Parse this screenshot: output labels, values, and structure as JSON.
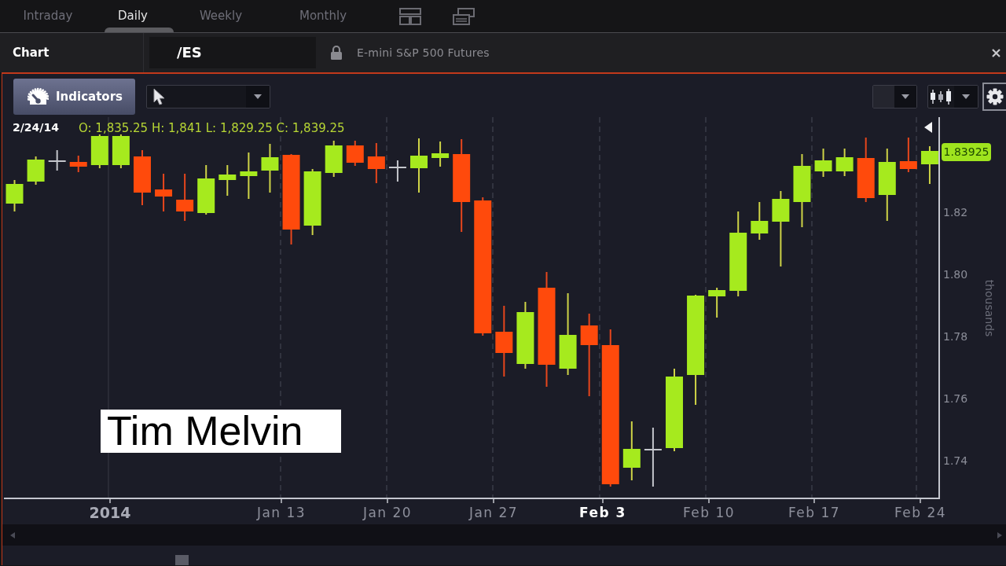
{
  "tabs": [
    {
      "label": "Intraday",
      "selected": false
    },
    {
      "label": "Daily",
      "selected": true
    },
    {
      "label": "Weekly",
      "selected": false
    },
    {
      "label": "Monthly",
      "selected": false
    }
  ],
  "panel": {
    "title": "Chart",
    "symbol": "/ES",
    "description": "E-mini S&P 500 Futures"
  },
  "toolbar": {
    "indicators_button": "Indicators"
  },
  "chart": {
    "readout": {
      "date": "2/24/14",
      "ohlc": "O: 1,835.25 H: 1,841 L: 1,829.25 C: 1,839.25"
    },
    "last_price": "1.83925",
    "y_ticks": [
      "1.82",
      "1.80",
      "1.78",
      "1.76",
      "1.74"
    ],
    "y_unit": "thousands",
    "x_labels": [
      {
        "text": "2014",
        "kind": "year"
      },
      {
        "text": "Jan 13",
        "kind": "week"
      },
      {
        "text": "Jan 20",
        "kind": "week"
      },
      {
        "text": "Jan 27",
        "kind": "week"
      },
      {
        "text": "Feb 3",
        "kind": "month"
      },
      {
        "text": "Feb 10",
        "kind": "week"
      },
      {
        "text": "Feb 17",
        "kind": "week"
      },
      {
        "text": "Feb 24",
        "kind": "week"
      }
    ]
  },
  "caption": "Tim Melvin"
}
